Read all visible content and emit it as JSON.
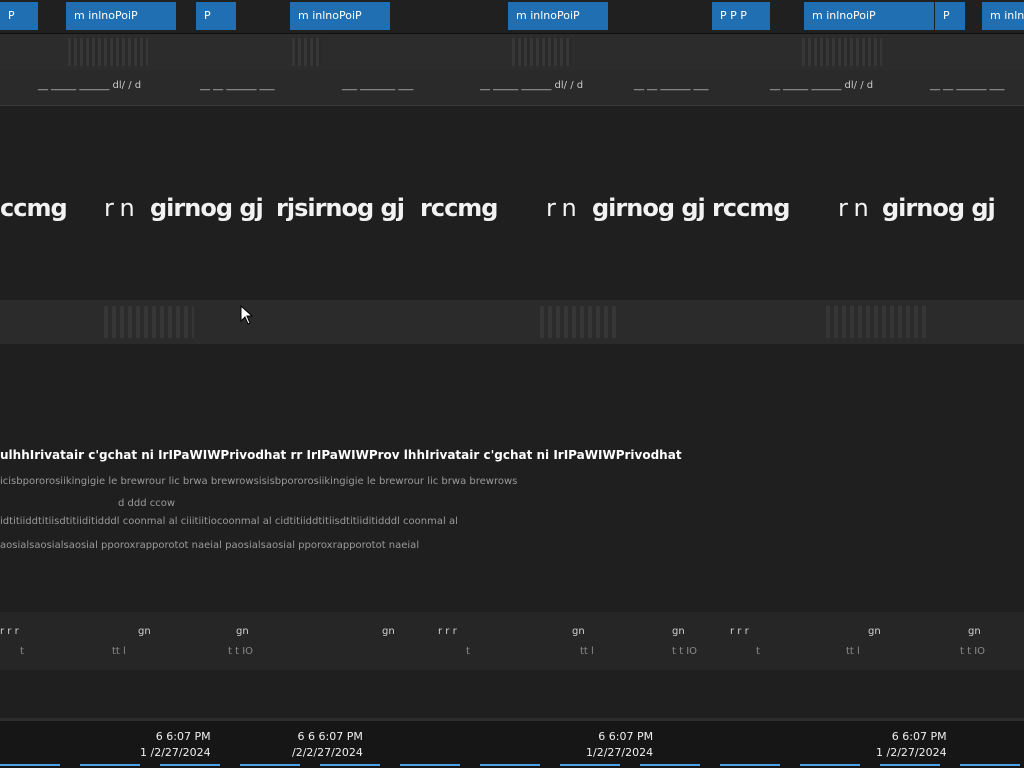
{
  "tabs": [
    {
      "label": "P",
      "state": "active"
    },
    {
      "label": "m inlnoPoiP",
      "state": "active"
    },
    {
      "label": "P",
      "state": "active"
    },
    {
      "label": "m inlnoPoiP",
      "state": "active"
    },
    {
      "label": "m inlnoPoiP",
      "state": "active"
    },
    {
      "label": "P P P",
      "state": "active"
    },
    {
      "label": "m inlnoPoiP",
      "state": "active"
    },
    {
      "label": "P",
      "state": "active"
    },
    {
      "label": "m inlnoPoiP",
      "state": "active"
    }
  ],
  "bookmarks": [
    "__ _____  ______ dl/ / d",
    "__ __ ______  ___",
    "___ _______  ___",
    "__ _____  ______ dl/ / d",
    "__ __ ______  ___",
    "__ _____  ______ dl/ / d",
    "__ __ ______  ___"
  ],
  "hero": {
    "segments": [
      "ccmg",
      "r n",
      "girnog gj",
      "rjsirnog gj",
      "rccmg",
      "r n",
      "girnog gj",
      "rccmg",
      "r n",
      "girnog gj"
    ]
  },
  "notice": {
    "title": "ulhhIrivatair c'gchat ni IrIPaWIWPrivodhat rr IrIPaWIWProv lhhIrivatair c'gchat ni IrIPaWIWPrivodhat",
    "lines": [
      "icisbpororosiikingigie le brewrour lic brwa brewrowsisisbpororosiikingigie le brewrour lic brwa brewrows",
      "d ddd  ccow",
      "idtitiiddtitiisdtitiiditidddl coonmal al  ciiitiitiocoonmal al  cidtitiiddtitiisdtitiiditidddl coonmal al",
      "aosialsaosialsaosial pporoxrapporotot   naeial paosialsaosial pporoxrapporotot   naeial"
    ]
  },
  "footer": {
    "top": [
      "r  r   r",
      "gn",
      "gn",
      "gn",
      "r  r   r",
      "gn",
      "gn",
      "r  r   r",
      "gn",
      "gn"
    ],
    "bottom": [
      "t",
      "tt l",
      "t t IO",
      "t",
      "tt l",
      "t t IO",
      "t",
      "tt l",
      "t t IO"
    ]
  },
  "taskbar": {
    "clocks": [
      {
        "time": "6 6:07 PM",
        "date": "1 /2/27/2024"
      },
      {
        "time": "6 6 6:07 PM",
        "date": "/2/2/27/2024"
      },
      {
        "time": "6 6:07 PM",
        "date": "1/2/27/2024"
      },
      {
        "time": "6 6:07 PM",
        "date": "1 /2/27/2024"
      }
    ]
  },
  "colors": {
    "tab_active": "#1f6fb2",
    "background": "#1f1f1f",
    "taskbar_accent": "#4aa3e8"
  }
}
